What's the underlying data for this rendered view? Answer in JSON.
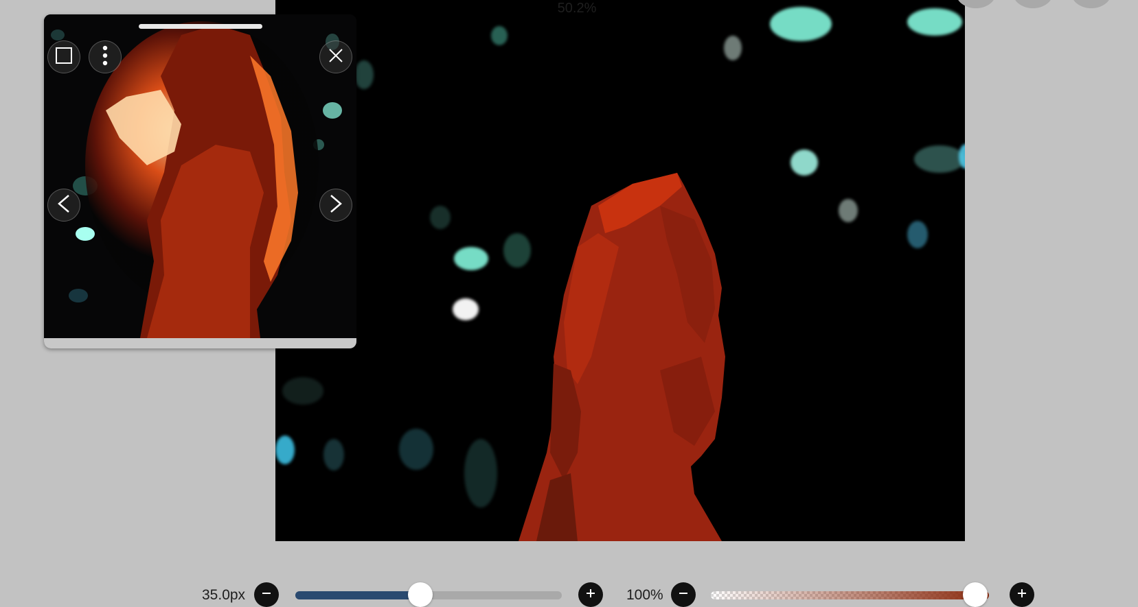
{
  "canvas": {
    "zoom_label": "50.2%",
    "background_color": "#000000"
  },
  "reference_window": {
    "buttons": {
      "frame": "square-frame-icon",
      "menu": "vertical-dots-icon",
      "close": "close-x-icon",
      "previous": "chevron-left-icon",
      "next": "chevron-right-icon"
    }
  },
  "toolbar": {
    "brush_size": {
      "label": "35.0px",
      "value_fraction": 0.47,
      "fill_color": "#2a4a70"
    },
    "opacity": {
      "label": "100%",
      "value_fraction": 1.0,
      "gradient_color": "#8a2a0e"
    },
    "icons": {
      "size_minus": "minus-icon",
      "size_plus": "plus-icon",
      "opacity_minus": "minus-icon",
      "opacity_plus": "plus-icon"
    }
  },
  "colors": {
    "app_background": "#c2c2c2",
    "figure_red": "#b8260c",
    "bokeh_teal": "#7de8d0"
  }
}
